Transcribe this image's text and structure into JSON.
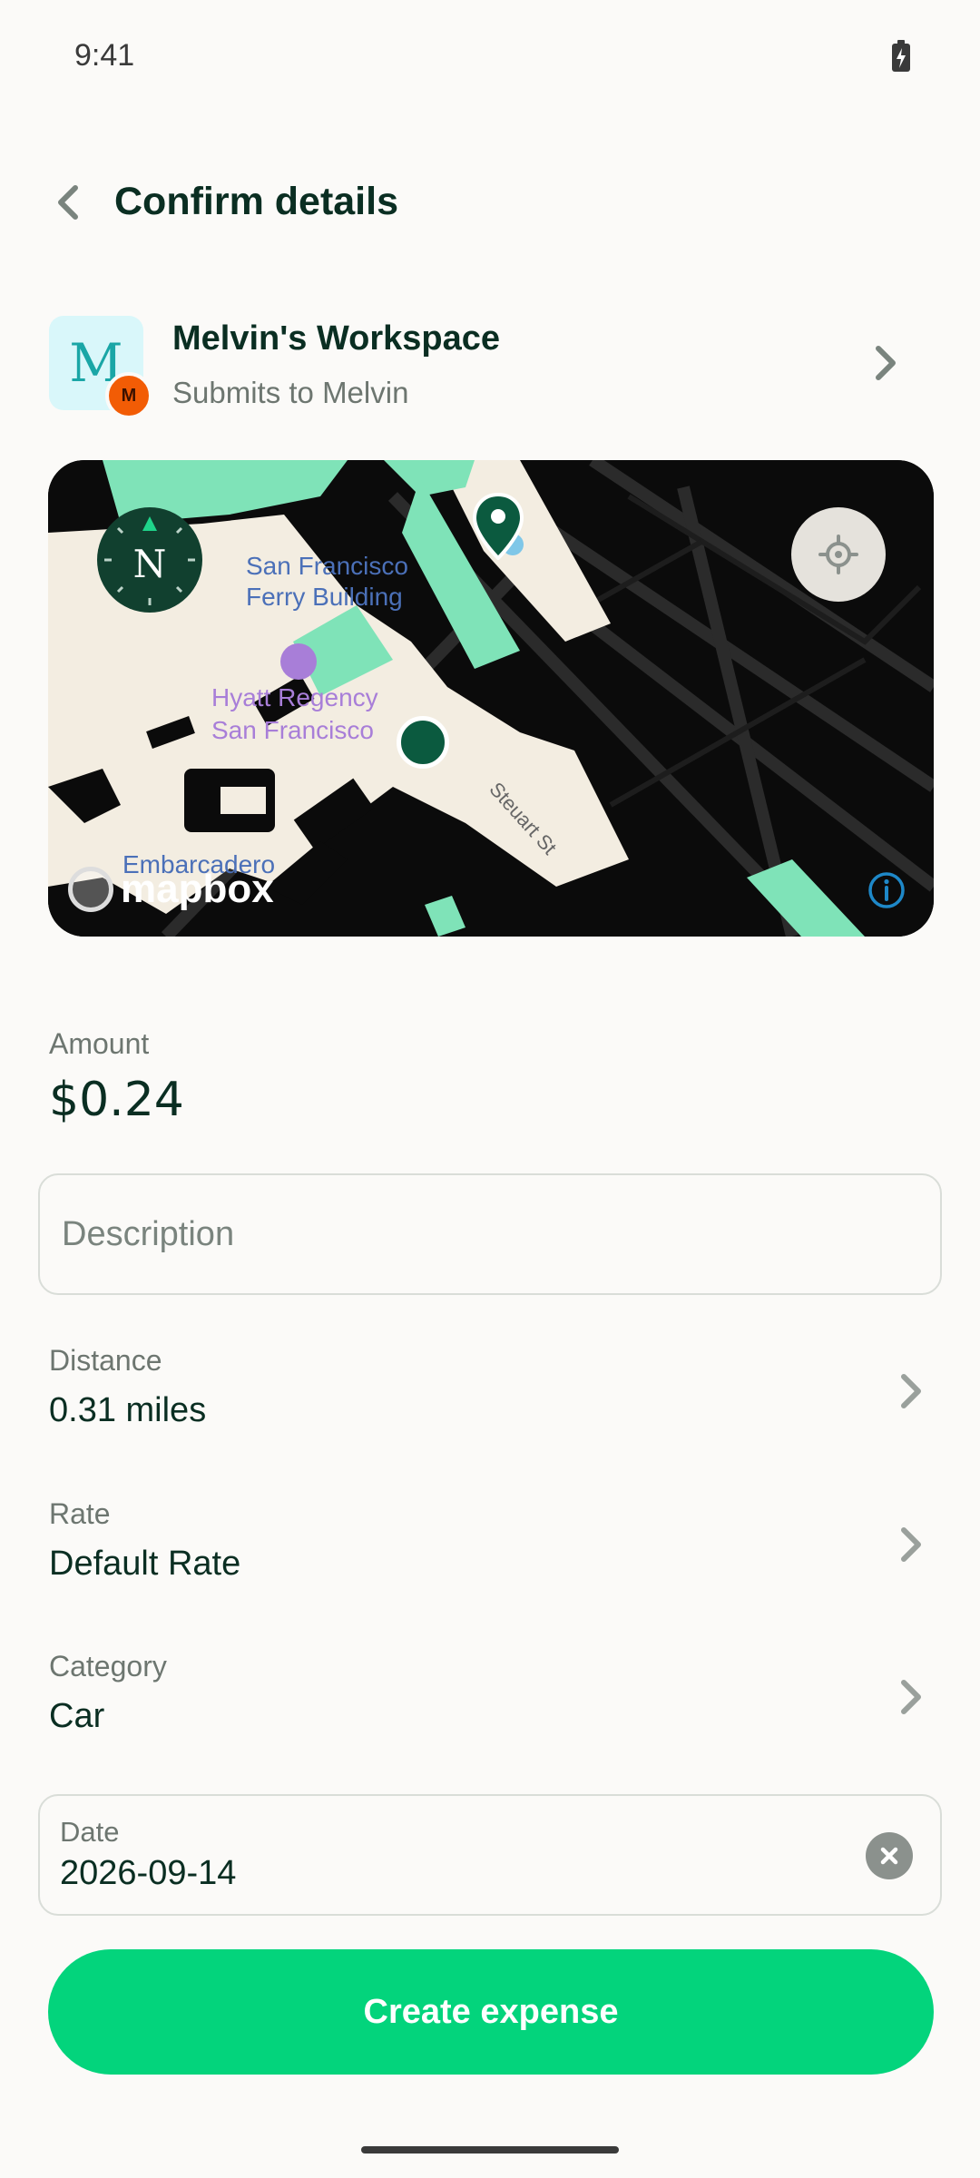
{
  "status_bar": {
    "time": "9:41",
    "battery_icon": "battery-charging-icon"
  },
  "header": {
    "title": "Confirm details",
    "back_icon": "chevron-left-icon"
  },
  "workspace": {
    "avatar_letter": "M",
    "sub_avatar_letter": "M",
    "name": "Melvin's Workspace",
    "subtitle": "Submits to Melvin"
  },
  "map": {
    "labels": {
      "ferry": "San Francisco\nFerry Building",
      "hyatt": "Hyatt Regency\nSan Francisco",
      "embarcadero": "Embarcadero",
      "street": "Steuart St"
    },
    "compass_letter": "N",
    "attribution": "mapbox"
  },
  "amount": {
    "label": "Amount",
    "value": "$0.24"
  },
  "description": {
    "placeholder": "Description",
    "value": ""
  },
  "rows": {
    "distance": {
      "label": "Distance",
      "value": "0.31 miles"
    },
    "rate": {
      "label": "Rate",
      "value": "Default Rate"
    },
    "category": {
      "label": "Category",
      "value": "Car"
    }
  },
  "date": {
    "label": "Date",
    "value": "2026-09-14"
  },
  "create_button": {
    "label": "Create expense"
  },
  "colors": {
    "accent": "#03D47C",
    "dark_green": "#0A2E22",
    "muted": "#6D7670",
    "background": "#FBFAF8"
  }
}
